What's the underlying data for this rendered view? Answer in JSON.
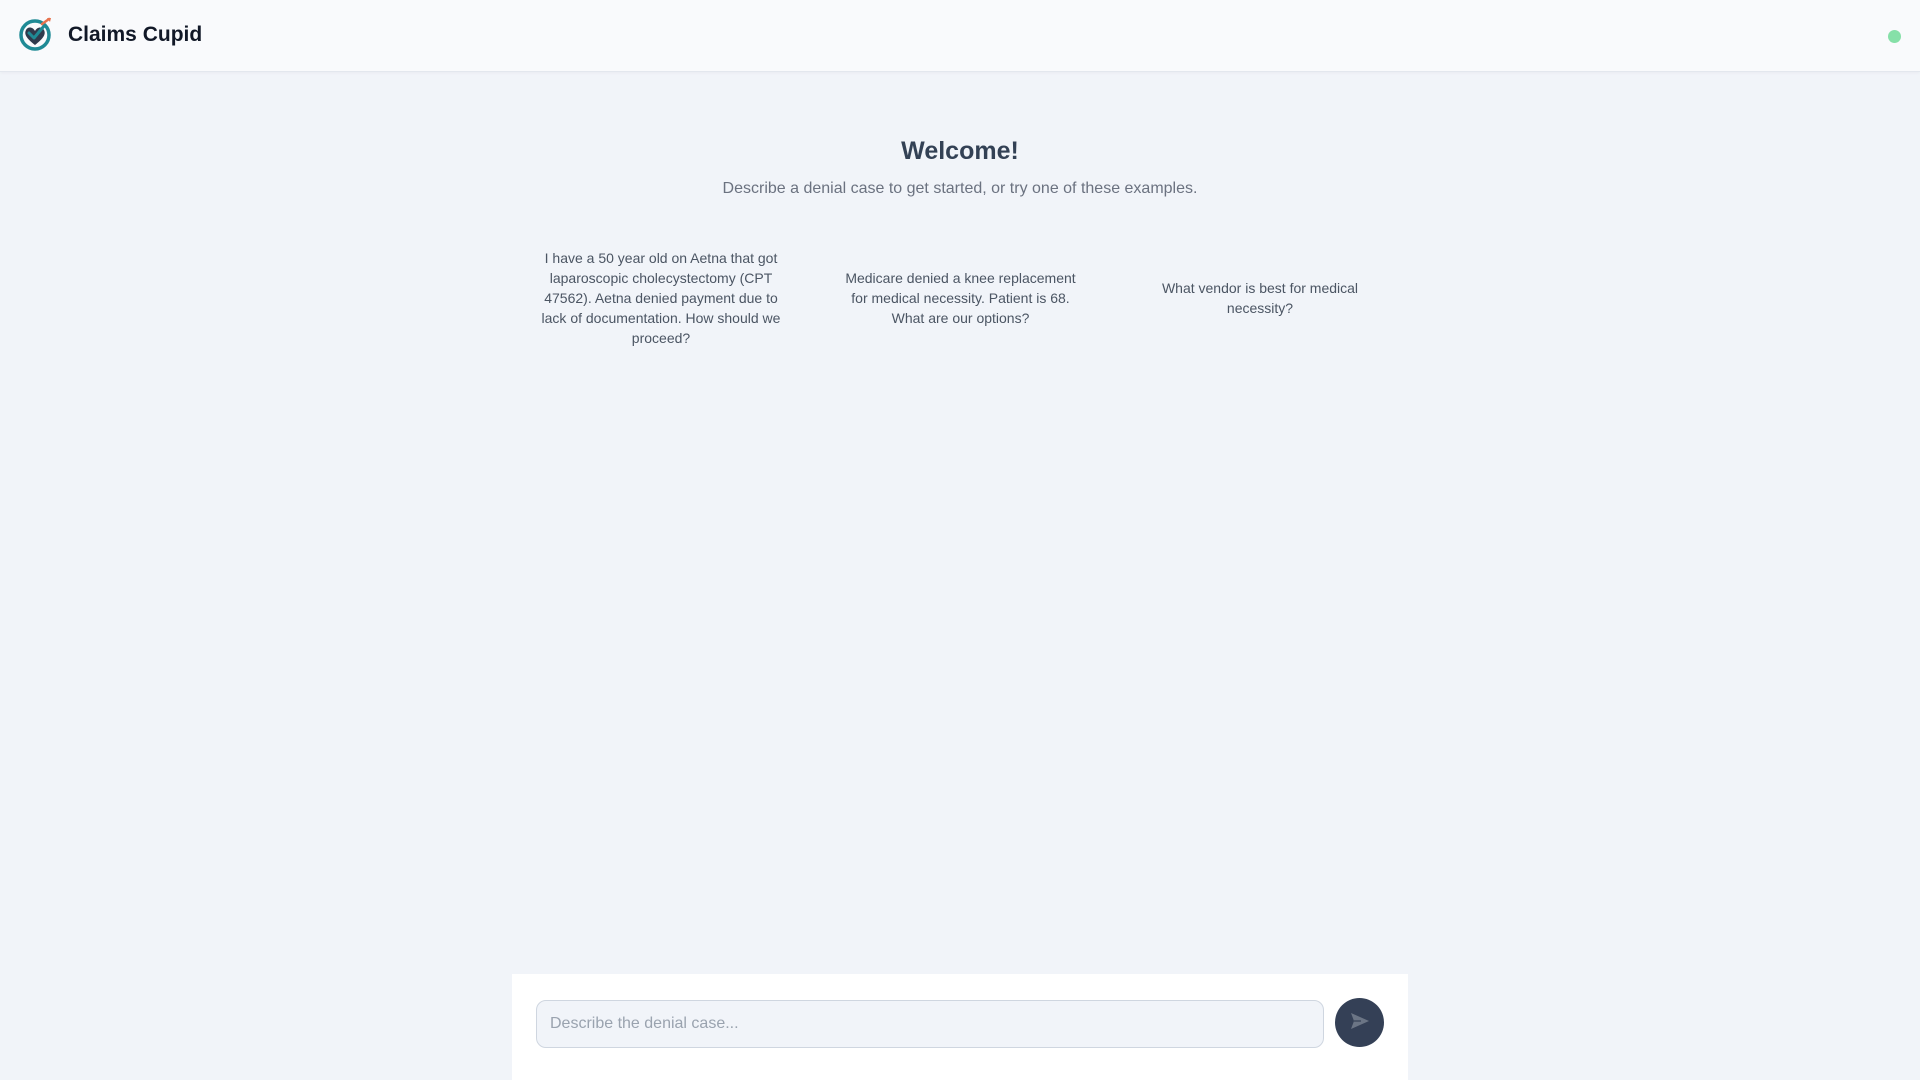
{
  "header": {
    "app_title": "Claims Cupid",
    "logo_icon": "heart-check-logo-icon",
    "status_indicator": {
      "icon": "status-dot-icon",
      "color": "#86e0a8",
      "state": "online"
    }
  },
  "welcome": {
    "title": "Welcome!",
    "subtitle": "Describe a denial case to get started, or try one of these examples."
  },
  "examples": [
    {
      "text": "I have a 50 year old on Aetna that got laparoscopic cholecystectomy (CPT 47562). Aetna denied payment due to lack of documentation. How should we proceed?"
    },
    {
      "text": "Medicare denied a knee replacement for medical necessity. Patient is 68. What are our options?"
    },
    {
      "text": "What vendor is best for medical necessity?"
    }
  ],
  "composer": {
    "placeholder": "Describe the denial case...",
    "value": "",
    "send_icon": "paper-plane-send-icon"
  },
  "colors": {
    "background": "#f1f4f9",
    "header_background": "#f9fafc",
    "send_button": "#344056",
    "logo_teal": "#1f8a95",
    "logo_dark": "#2f3a4c",
    "logo_accent": "#e8724d"
  }
}
